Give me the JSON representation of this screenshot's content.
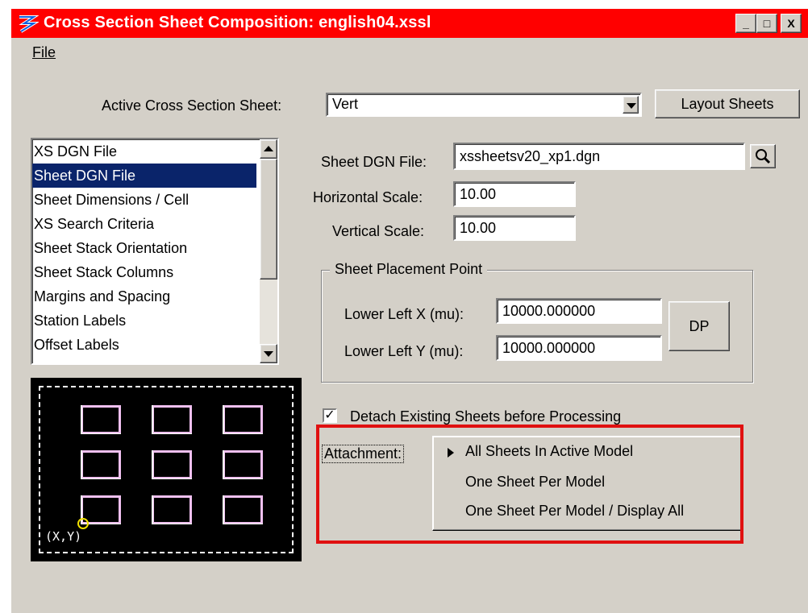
{
  "window": {
    "title": "Cross Section Sheet Composition: english04.xssl",
    "buttons": {
      "minimize": "_",
      "maximize": "□",
      "close": "X"
    }
  },
  "menu": {
    "file": "File"
  },
  "active_sheet": {
    "label": "Active Cross Section Sheet:",
    "value": "Vert",
    "layout_button": "Layout Sheets"
  },
  "category_list": {
    "items": [
      "XS DGN File",
      "Sheet DGN File",
      "Sheet Dimensions / Cell",
      "XS Search Criteria",
      "Sheet Stack Orientation",
      "Sheet Stack Columns",
      "Margins and Spacing",
      "Station Labels",
      "Offset Labels"
    ],
    "selected": "Sheet DGN File"
  },
  "sheet_dgn": {
    "file_label": "Sheet DGN File:",
    "file_value": "xssheetsv20_xp1.dgn",
    "hscale_label": "Horizontal Scale:",
    "hscale_value": "10.00",
    "vscale_label": "Vertical Scale:",
    "vscale_value": "10.00"
  },
  "placement": {
    "group_title": "Sheet Placement Point",
    "x_label": "Lower Left X (mu):",
    "x_value": "10000.000000",
    "y_label": "Lower Left Y (mu):",
    "y_value": "10000.000000",
    "dp_button": "DP"
  },
  "detach": {
    "label": "Detach Existing Sheets before Processing",
    "checked": true
  },
  "attachment": {
    "label": "Attachment:",
    "options": [
      "All Sheets In Active Model",
      "One Sheet Per Model",
      "One Sheet Per Model / Display All"
    ],
    "selected": "All Sheets In Active Model"
  },
  "preview": {
    "origin_label": "(X,Y)"
  },
  "colors": {
    "titlebar": "#ff0000",
    "dialog_bg": "#d4d0c8",
    "selection": "#0a246a",
    "sheet_outline": "#f0c0f0",
    "annotation_box": "#e01010"
  }
}
